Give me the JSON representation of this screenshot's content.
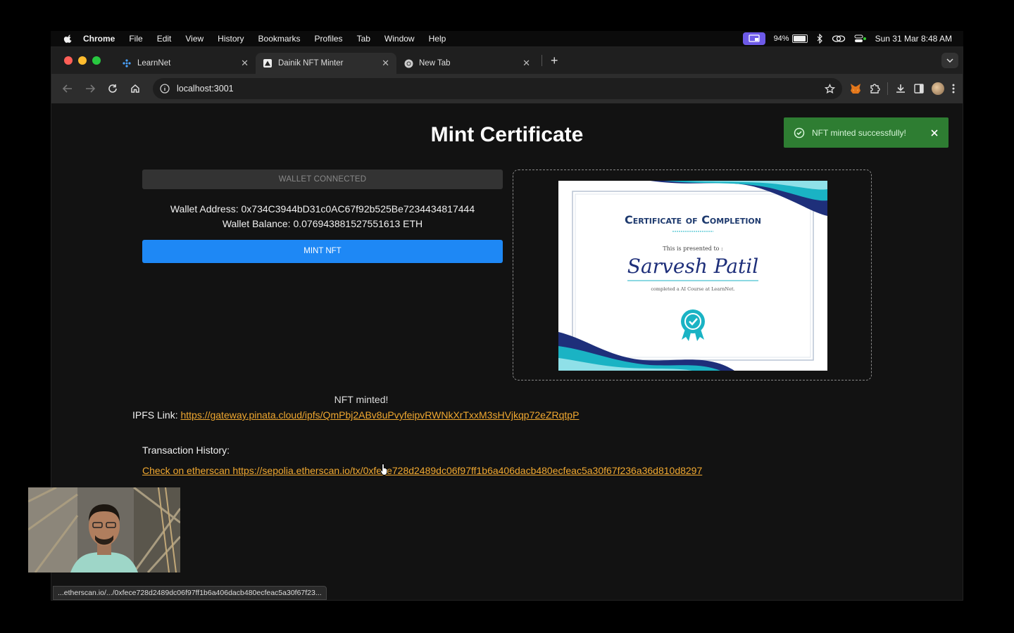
{
  "menubar": {
    "items": [
      "Chrome",
      "File",
      "Edit",
      "View",
      "History",
      "Bookmarks",
      "Profiles",
      "Tab",
      "Window",
      "Help"
    ],
    "battery": "94%",
    "clock": "Sun 31 Mar  8:48 AM"
  },
  "tabs": [
    {
      "title": "LearnNet",
      "icon": "learnnet-icon"
    },
    {
      "title": "Dainik NFT Minter",
      "icon": "app-icon"
    },
    {
      "title": "New Tab",
      "icon": "chrome-icon"
    }
  ],
  "address_bar": {
    "url": "localhost:3001"
  },
  "page": {
    "title": "Mint Certificate",
    "toast": "NFT minted successfully!",
    "wallet_button": "WALLET CONNECTED",
    "wallet_address": "Wallet Address: 0x734C3944bD31c0AC67f92b525Be7234434817444",
    "wallet_balance": "Wallet Balance: 0.076943881527551613 ETH",
    "mint_button": "MINT NFT",
    "minted_text": "NFT minted!",
    "ipfs_label": "IPFS Link: ",
    "ipfs_url": "https://gateway.pinata.cloud/ipfs/QmPbj2ABv8uPvyfeipvRWNkXrTxxM3sHVjkqp72eZRqtpP",
    "tx_heading": "Transaction History:",
    "tx_link": "Check on etherscan https://sepolia.etherscan.io/tx/0xfece728d2489dc06f97ff1b6a406dacb480ecfeac5a30f67f236a36d810d8297"
  },
  "certificate": {
    "heading": "Certificate of Completion",
    "presented": "This is presented to :",
    "name": "Sarvesh Patil",
    "description": "completed a AI Course at LearnNet."
  },
  "status_bar": "...etherscan.io/.../0xfece728d2489dc06f97ff1b6a406dacb480ecfeac5a30f67f23...",
  "colors": {
    "accent_blue": "#1e88f5",
    "toast_green": "#2e7d32",
    "link_orange": "#f0a830"
  }
}
